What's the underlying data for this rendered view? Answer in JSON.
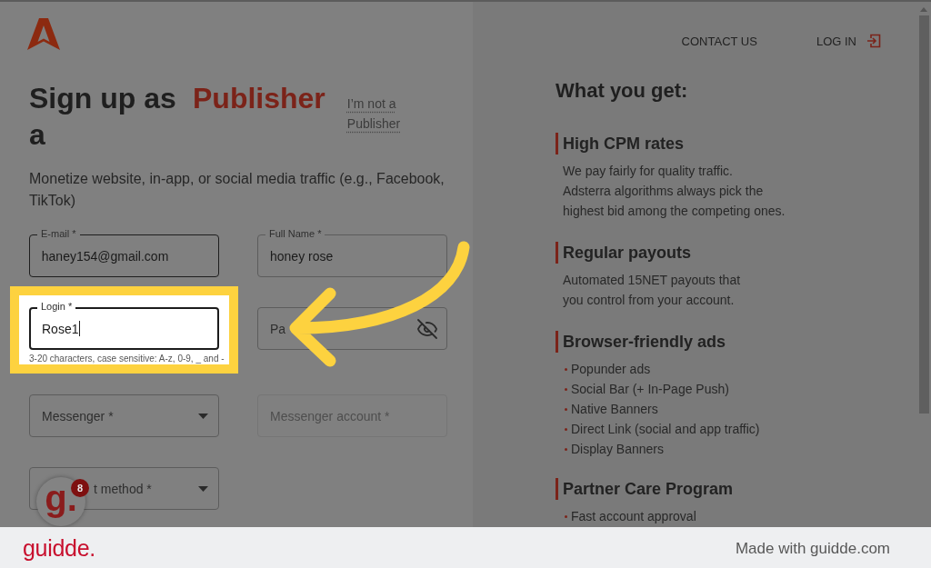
{
  "header": {
    "nav": [
      {
        "label": "CONTACT US",
        "kind": "link"
      },
      {
        "label": "LOG IN",
        "kind": "login"
      }
    ]
  },
  "signup": {
    "title": "Sign up as a",
    "role": "Publisher",
    "switch_link": "I’m not a Publisher",
    "subtitle": "Monetize website, in-app, or social media traffic (e.g., Facebook, TikTok)",
    "fields": [
      {
        "kind": "text",
        "label": "E-mail *",
        "value": "haney154@gmail.com",
        "focused": false,
        "hovered": true,
        "disabled": false,
        "spotlight": false,
        "badge_over": false
      },
      {
        "kind": "text",
        "label": "Full Name *",
        "value": "honey rose",
        "focused": false,
        "hovered": false,
        "disabled": false,
        "spotlight": false,
        "badge_over": false
      },
      {
        "kind": "text",
        "label": "Login *",
        "value": "Rose1",
        "helper": "3-20 characters, case sensitive: A-z, 0-9, _ and -",
        "focused": true,
        "hovered": false,
        "disabled": false,
        "spotlight": true,
        "badge_over": false
      },
      {
        "kind": "password",
        "placeholder": "Pa",
        "focused": false,
        "hovered": false,
        "disabled": false,
        "spotlight": false,
        "badge_over": false
      },
      {
        "kind": "select",
        "placeholder": "Messenger *",
        "focused": false,
        "hovered": false,
        "disabled": false,
        "spotlight": false,
        "badge_over": false
      },
      {
        "kind": "text",
        "placeholder": "Messenger account *",
        "focused": false,
        "hovered": false,
        "disabled": true,
        "spotlight": false,
        "badge_over": false
      },
      {
        "kind": "select",
        "placeholder": "t method *",
        "focused": false,
        "hovered": false,
        "disabled": false,
        "spotlight": false,
        "badge_over": true
      }
    ]
  },
  "benefits": {
    "title": "What you get:",
    "sections": [
      {
        "kind": "text",
        "heading": "High CPM rates",
        "text": "We pay fairly for quality traffic.\nAdsterra algorithms always pick the\nhighest bid among the competing ones."
      },
      {
        "kind": "text",
        "heading": "Regular payouts",
        "text": "Automated 15NET payouts that\nyou control from your account."
      },
      {
        "kind": "list",
        "heading": "Browser-friendly ads",
        "items": [
          "Popunder ads",
          "Social Bar (+ In-Page Push)",
          "Native Banners",
          "Direct Link (social and app traffic)",
          "Display Banners"
        ]
      },
      {
        "kind": "list",
        "heading": "Partner Care Program",
        "items": [
          "Fast account approval"
        ]
      }
    ]
  },
  "guidde_badge": {
    "logo": "g.",
    "count": "8"
  },
  "footer": {
    "logo": "guidde.",
    "credit": "Made with guidde.com"
  }
}
